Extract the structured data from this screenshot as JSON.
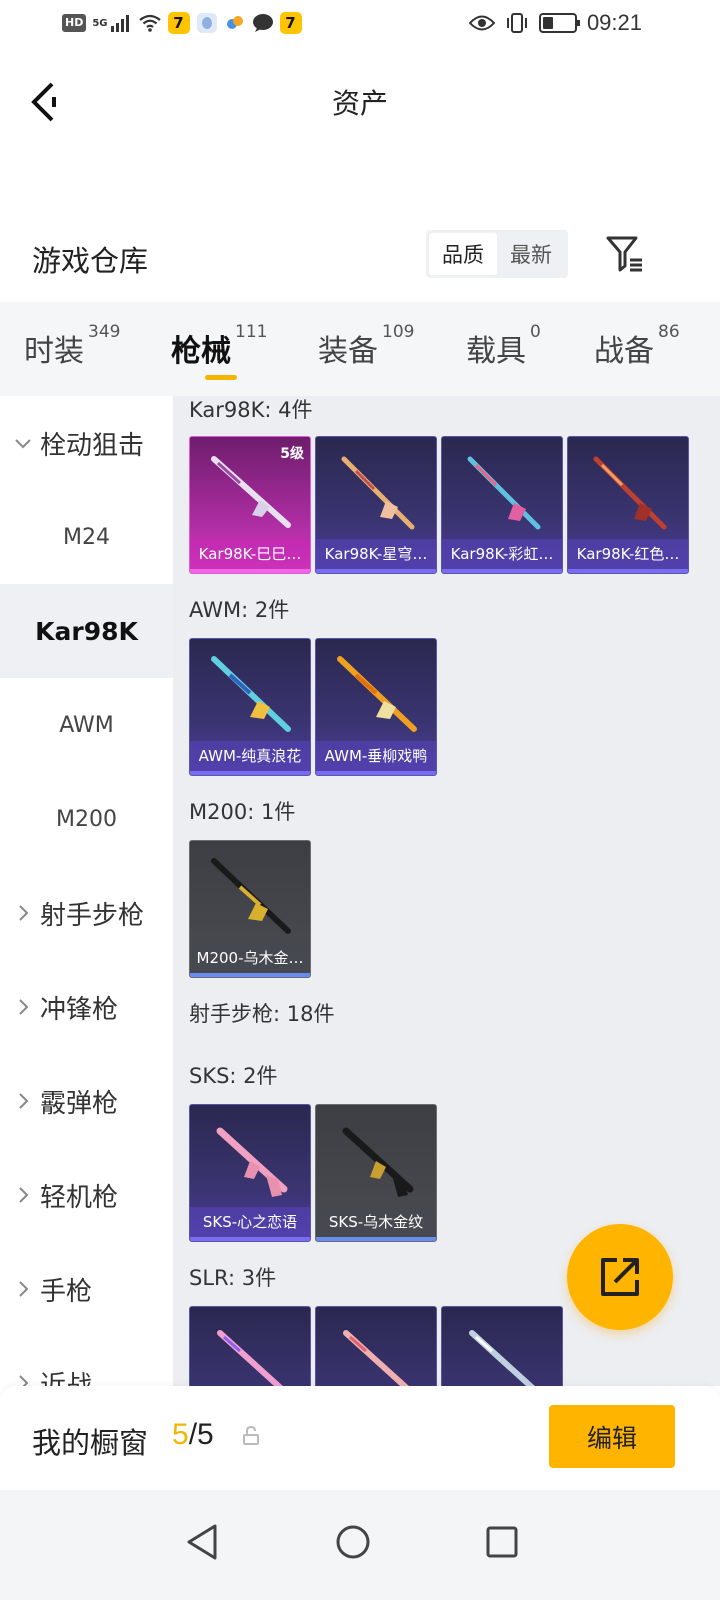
{
  "status_bar": {
    "hd": "HD",
    "network": "5G",
    "time": "09:21"
  },
  "header": {
    "title": "资产"
  },
  "warehouse": {
    "title": "游戏仓库",
    "sort_options": [
      "品质",
      "最新"
    ],
    "sort_selected": "品质"
  },
  "tabs": [
    {
      "label": "时装",
      "count": "349"
    },
    {
      "label": "枪械",
      "count": "111",
      "active": true
    },
    {
      "label": "装备",
      "count": "109"
    },
    {
      "label": "载具",
      "count": "0"
    },
    {
      "label": "战备",
      "count": "86"
    }
  ],
  "sidebar": {
    "items": [
      {
        "label": "栓动狙击",
        "type": "group",
        "expanded": true
      },
      {
        "label": "M24",
        "type": "sub"
      },
      {
        "label": "Kar98K",
        "type": "sub",
        "selected": true
      },
      {
        "label": "AWM",
        "type": "sub"
      },
      {
        "label": "M200",
        "type": "sub"
      },
      {
        "label": "射手步枪",
        "type": "group"
      },
      {
        "label": "冲锋枪",
        "type": "group"
      },
      {
        "label": "霰弹枪",
        "type": "group"
      },
      {
        "label": "轻机枪",
        "type": "group"
      },
      {
        "label": "手枪",
        "type": "group"
      },
      {
        "label": "近战",
        "type": "group"
      }
    ]
  },
  "content": {
    "sections": [
      {
        "title": "Kar98K: 4件"
      },
      {
        "title": "AWM: 2件"
      },
      {
        "title": "M200: 1件"
      },
      {
        "title": "射手步枪: 18件"
      },
      {
        "title": "SKS: 2件"
      },
      {
        "title": "SLR: 3件"
      }
    ],
    "items": {
      "kar98k": [
        {
          "label": "Kar98K-巳巳…",
          "badge": "5级",
          "style": "pink"
        },
        {
          "label": "Kar98K-星穹…",
          "style": "purple"
        },
        {
          "label": "Kar98K-彩虹…",
          "style": "purple"
        },
        {
          "label": "Kar98K-红色…",
          "style": "purple"
        }
      ],
      "awm": [
        {
          "label": "AWM-纯真浪花",
          "style": "purple"
        },
        {
          "label": "AWM-垂柳戏鸭",
          "style": "purple"
        }
      ],
      "m200": [
        {
          "label": "M200-乌木金…",
          "style": "gray"
        }
      ],
      "sks": [
        {
          "label": "SKS-心之恋语",
          "style": "purple"
        },
        {
          "label": "SKS-乌木金纹",
          "style": "gray"
        }
      ]
    }
  },
  "showcase": {
    "title": "我的橱窗",
    "current": "5",
    "separator": "/",
    "total": "5",
    "edit_label": "编辑"
  },
  "colors": {
    "accent": "#ffb400",
    "tab_underline": "#f5b400",
    "content_bg": "#eceef1"
  }
}
